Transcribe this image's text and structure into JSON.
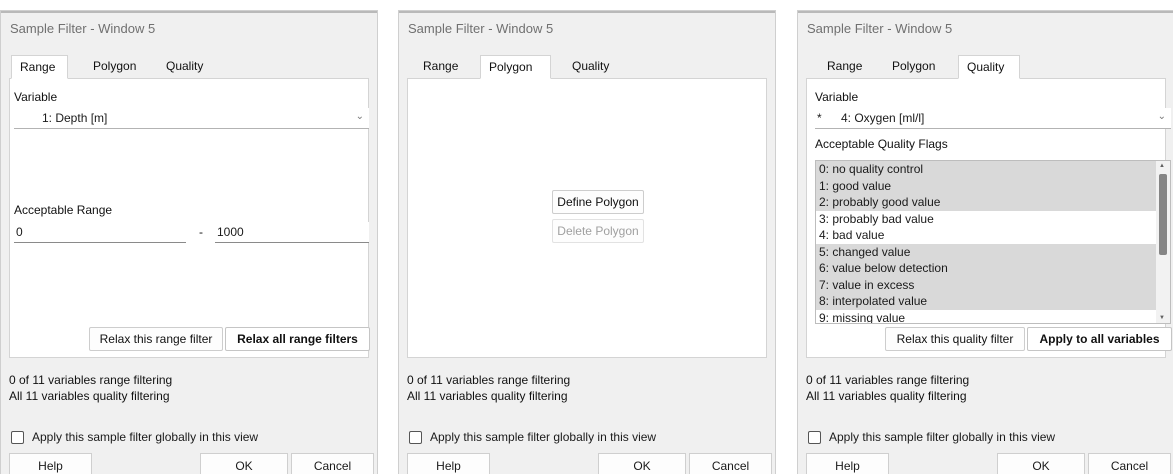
{
  "window_title": "Sample Filter - Window 5",
  "tabs": [
    "Range",
    "Polygon",
    "Quality"
  ],
  "range": {
    "variable_label": "Variable",
    "variable_value": "1: Depth [m]",
    "acceptable_label": "Acceptable Range",
    "min": "0",
    "dash": "-",
    "max": "1000",
    "relax_this": "Relax this range filter",
    "relax_all": "Relax all range filters"
  },
  "polygon": {
    "define": "Define Polygon",
    "delete": "Delete Polygon"
  },
  "quality": {
    "variable_label": "Variable",
    "variable_marker": "*",
    "variable_value": "4: Oxygen [ml/l]",
    "flags_label": "Acceptable Quality Flags",
    "flags": [
      "0: no quality control",
      "1: good value",
      "2: probably good value",
      "3: probably bad value",
      "4: bad value",
      "5: changed value",
      "6: value below detection",
      "7: value in excess",
      "8: interpolated value",
      "9: missing value"
    ],
    "selected": [
      true,
      true,
      true,
      false,
      false,
      true,
      true,
      true,
      true,
      false
    ],
    "relax_this": "Relax this quality filter",
    "apply_all": "Apply to all variables"
  },
  "status": {
    "range_line": "0 of 11 variables range filtering",
    "quality_line": "All 11 variables quality filtering"
  },
  "checkbox_label": "Apply this sample filter globally in this view",
  "buttons": {
    "help": "Help",
    "ok": "OK",
    "cancel": "Cancel"
  },
  "icons": {
    "dropdown": "chevron-down-icon",
    "scroll_up": "arrow-up-icon",
    "scroll_down": "arrow-down-icon"
  }
}
